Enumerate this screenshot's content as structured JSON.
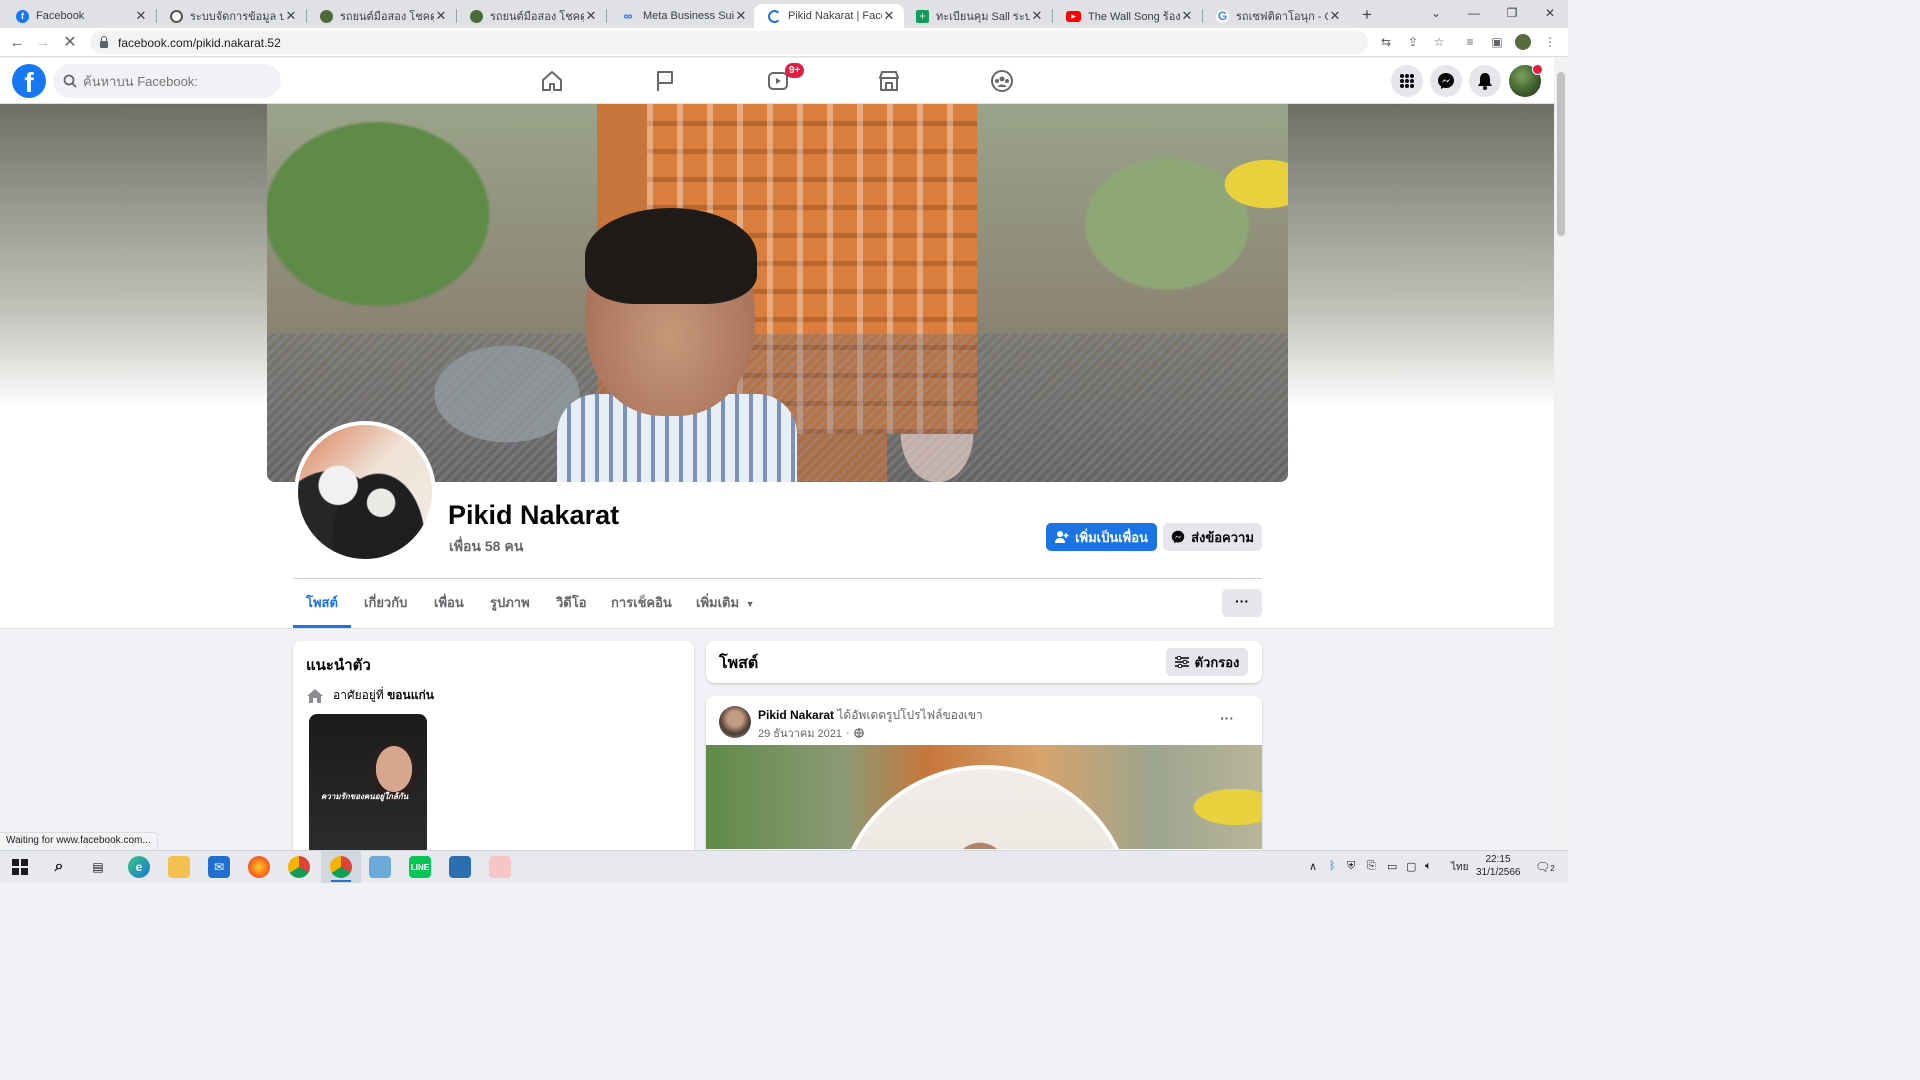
{
  "browser": {
    "tabs": [
      {
        "title": "Facebook",
        "favicon": "facebook-favicon"
      },
      {
        "title": "ระบบจัดการข้อมูล บริษัท",
        "favicon": "globe-favicon"
      },
      {
        "title": "รถยนต์มือสอง โชคดูกโอ",
        "favicon": "car-favicon"
      },
      {
        "title": "รถยนต์มือสอง โชคดูกโอ",
        "favicon": "car-favicon"
      },
      {
        "title": "Meta Business Suite",
        "favicon": "meta-favicon"
      },
      {
        "title": "Pikid Nakarat | Facebo",
        "favicon": "loading-favicon"
      },
      {
        "title": "ทะเบียนคุม Sall ระบบออน",
        "favicon": "sheets-favicon"
      },
      {
        "title": "The Wall Song ร้องข้าม",
        "favicon": "youtube-favicon"
      },
      {
        "title": "รถเซฟติดาโอนุก - Goog",
        "favicon": "google-favicon"
      }
    ],
    "url": "facebook.com/pikid.nakarat.52",
    "status_text": "Waiting for www.facebook.com..."
  },
  "facebook": {
    "search_placeholder": "ค้นหาบน Facebook:",
    "video_badge": "9+"
  },
  "profile": {
    "name": "Pikid Nakarat",
    "friends": "เพื่อน 58 คน",
    "add_friend_label": "เพิ่มเป็นเพื่อน",
    "message_label": "ส่งข้อความ",
    "more_label": "···",
    "tabs": [
      "โพสต์",
      "เกี่ยวกับ",
      "เพื่อน",
      "รูปภาพ",
      "วิดีโอ",
      "การเช็คอิน",
      "เพิ่มเติม"
    ]
  },
  "intro": {
    "title": "แนะนำตัว",
    "lives_in_prefix": "อาศัยอยู่ที่",
    "lives_in_city": "ขอนแก่น",
    "photo_caption": "ความรักของคนอยู่ใกล้กัน"
  },
  "posts": {
    "title": "โพสต์",
    "filter_label": "ตัวกรอง",
    "items": [
      {
        "author": "Pikid Nakarat",
        "action": "ได้อัพเดตรูปโปรไฟล์ของเขา",
        "date": "29 ธันวาคม 2021",
        "privacy_icon": "globe-icon"
      }
    ]
  },
  "taskbar": {
    "language": "ไทย",
    "time": "22:15",
    "date": "31/1/2566",
    "notification_count": "2"
  },
  "colors": {
    "fb_blue": "#1877f2",
    "button_blue": "#1b74e4",
    "badge_red": "#e41e3f"
  }
}
